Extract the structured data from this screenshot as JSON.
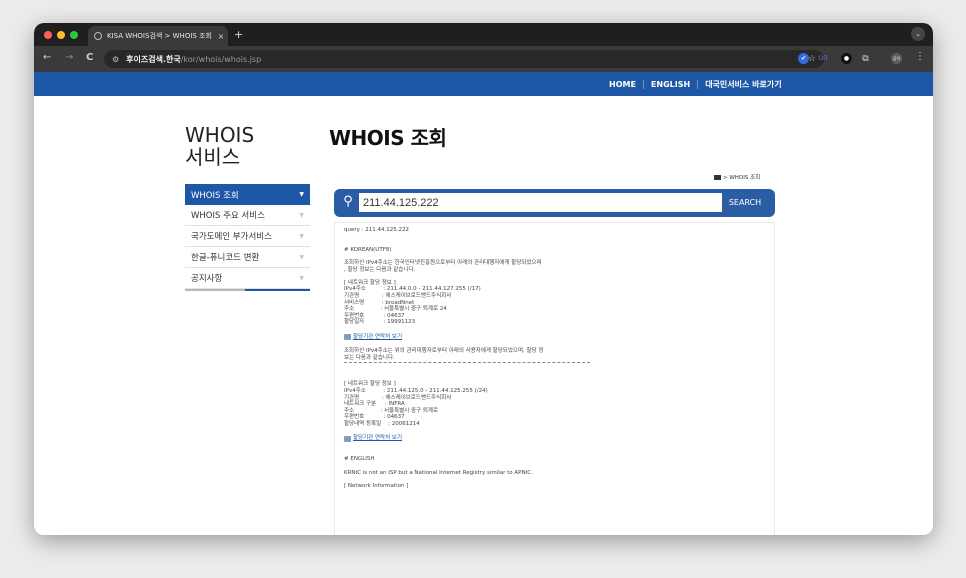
{
  "browser": {
    "tab_title": "KISA WHOIS검색 > WHOIS 조회",
    "tab_close": "×",
    "new_tab": "+",
    "url_host": "후이즈검색.한국",
    "url_path": "/kor/whois/whois.jsp",
    "back": "←",
    "forward": "→",
    "reload": "C",
    "star": "☆",
    "menu": "⋮",
    "tab_menu": "⌄",
    "ext_label": "ΟΠ",
    "profile_label": "공익"
  },
  "topnav": {
    "home": "HOME",
    "english": "ENGLISH",
    "shortcut": "대국민서비스 바로가기"
  },
  "sidebar": {
    "title_line1": "WHOIS",
    "title_line2": "서비스",
    "items": [
      {
        "label": "WHOIS 조회",
        "caret": "▼"
      },
      {
        "label": "WHOIS 주요 서비스",
        "caret": "▼"
      },
      {
        "label": "국가도메인 부가서비스",
        "caret": "▼"
      },
      {
        "label": "한글-퓨니코드 변환",
        "caret": "▼"
      },
      {
        "label": "공지사항",
        "caret": "▼"
      }
    ]
  },
  "main": {
    "title": "WHOIS 조회",
    "breadcrumb": "> WHOIS 조회",
    "search_value": "211.44.125.222",
    "search_button": "SEARCH",
    "search_icon_glyph": "⚲"
  },
  "result": {
    "query_line": "query : 211.44.125.222",
    "korean_header": "# KOREAN(UTF8)",
    "intro1": "조회하신 IPv4주소는 한국인터넷진흥원으로부터 아래의 관리대행자에게 할당되었으며",
    "intro2": ", 할당 정보는 다음과 같습니다.",
    "block1_header": "[ 네트워크 할당 정보 ]",
    "block1": [
      "IPv4주소          : 211.44.0.0 - 211.44.127.255 (/17)",
      "기관명             : 에스케이브로드밴드주식회사",
      "서비스명          : broadNnet",
      "주소               : 서울특별시 중구 퇴계로 24",
      "우편번호           : 04637",
      "할당일자           : 19991123"
    ],
    "contact_link": "할당기관 연락처 보기",
    "intro3": "조회하신 IPv4주소는 위의 관리대행자로부터 아래의 사용자에게 할당되었으며, 할당 정",
    "intro4": "보는 다음과 같습니다.",
    "block2_header": "[ 네트워크 할당 정보 ]",
    "block2": [
      "IPv4주소          : 211.44.125.0 - 211.44.125.255 (/24)",
      "기관명             : 에스케이브로드밴드주식회사",
      "네트워크 구분     : INFRA",
      "주소               : 서울특별시 중구 퇴계로",
      "우편번호           : 04637",
      "할당내역 등록일    : 20061214"
    ],
    "contact_link2": "할당기관 연락처 보기",
    "english_header": "# ENGLISH",
    "english_intro": "KRNIC is not an ISP but a National Internet Registry similar to APNIC.",
    "english_next": "[ Network Information ]"
  }
}
